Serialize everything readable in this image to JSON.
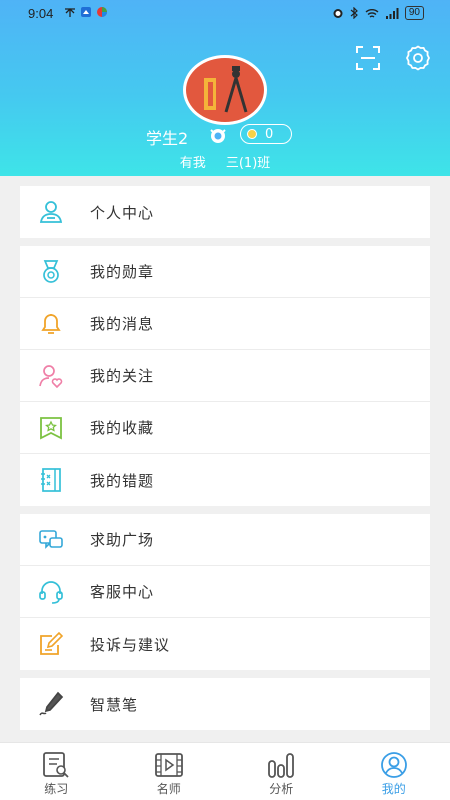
{
  "status": {
    "time": "9:04",
    "battery": "90"
  },
  "profile": {
    "name": "学生2",
    "coins": "0",
    "school": "有我",
    "class": "三(1)班"
  },
  "groups": [
    {
      "items": [
        {
          "label": "个人中心",
          "icon": "person-icon"
        }
      ]
    },
    {
      "items": [
        {
          "label": "我的勋章",
          "icon": "medal-icon"
        },
        {
          "label": "我的消息",
          "icon": "bell-icon"
        },
        {
          "label": "我的关注",
          "icon": "follow-icon"
        },
        {
          "label": "我的收藏",
          "icon": "bookmark-star-icon"
        },
        {
          "label": "我的错题",
          "icon": "notebook-icon"
        }
      ]
    },
    {
      "items": [
        {
          "label": "求助广场",
          "icon": "chat-bubbles-icon"
        },
        {
          "label": "客服中心",
          "icon": "headset-icon"
        },
        {
          "label": "投诉与建议",
          "icon": "edit-note-icon"
        }
      ]
    },
    {
      "items": [
        {
          "label": "智慧笔",
          "icon": "pen-icon"
        }
      ]
    }
  ],
  "tabs": [
    {
      "label": "练习",
      "icon": "practice-icon"
    },
    {
      "label": "名师",
      "icon": "video-icon"
    },
    {
      "label": "分析",
      "icon": "analysis-icon"
    },
    {
      "label": "我的",
      "icon": "profile-icon",
      "active": true
    }
  ],
  "colors": {
    "accent": "#3a9ee6",
    "header_top": "#4fb3f6",
    "header_bottom": "#3ee4e8"
  }
}
